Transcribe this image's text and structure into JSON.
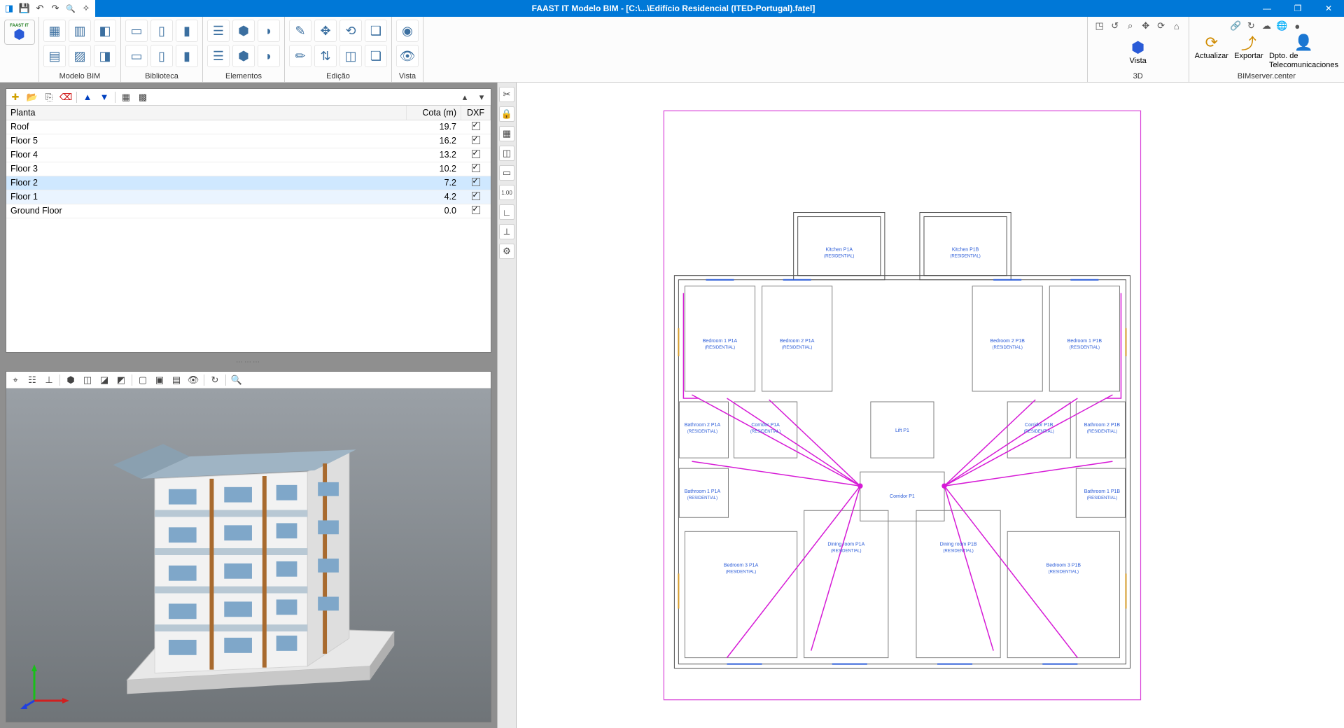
{
  "titlebar": {
    "title": "FAAST IT Modelo BIM - [C:\\...\\Edifício Residencial (ITED-Portugal).fatel]"
  },
  "ribbon": {
    "app_logo_top": "FAAST IT",
    "groups": {
      "modelo": "Modelo BIM",
      "biblioteca": "Biblioteca",
      "elementos": "Elementos",
      "edicao": "Edição",
      "vista": "Vista"
    },
    "right": {
      "vista": "Vista",
      "d3": "3D",
      "actualizar": "Actualizar",
      "exportar": "Exportar",
      "dpto": "Dpto. de\nTelecomunicaciones",
      "bimserver": "BIMserver.center"
    }
  },
  "floor_table": {
    "headers": {
      "planta": "Planta",
      "cota": "Cota (m)",
      "dxf": "DXF"
    },
    "rows": [
      {
        "name": "Roof",
        "cota": "19.7",
        "dxf": true,
        "selected": false
      },
      {
        "name": "Floor 5",
        "cota": "16.2",
        "dxf": true,
        "selected": false
      },
      {
        "name": "Floor 4",
        "cota": "13.2",
        "dxf": true,
        "selected": false
      },
      {
        "name": "Floor 3",
        "cota": "10.2",
        "dxf": true,
        "selected": false
      },
      {
        "name": "Floor 2",
        "cota": "7.2",
        "dxf": true,
        "selected": true
      },
      {
        "name": "Floor 1",
        "cota": "4.2",
        "dxf": true,
        "selected": "alt"
      },
      {
        "name": "Ground Floor",
        "cota": "0.0",
        "dxf": true,
        "selected": false
      }
    ]
  },
  "plan_rooms": {
    "kitchen_a": {
      "l1": "Kitchen P1A",
      "l2": "(RESIDENTIAL)"
    },
    "kitchen_b": {
      "l1": "Kitchen P1B",
      "l2": "(RESIDENTIAL)"
    },
    "bed1_a": {
      "l1": "Bedroom 1 P1A",
      "l2": "(RESIDENTIAL)"
    },
    "bed2_a": {
      "l1": "Bedroom 2 P1A",
      "l2": "(RESIDENTIAL)"
    },
    "bed2_b": {
      "l1": "Bedroom 2 P1B",
      "l2": "(RESIDENTIAL)"
    },
    "bed1_b": {
      "l1": "Bedroom 1 P1B",
      "l2": "(RESIDENTIAL)"
    },
    "bath2_a": {
      "l1": "Bathroom 2 P1A",
      "l2": "(RESIDENTIAL)"
    },
    "corr_a": {
      "l1": "Corridor P1A",
      "l2": "(RESIDENTIAL)"
    },
    "lift": {
      "l1": "Lift P1",
      "l2": ""
    },
    "corr_b": {
      "l1": "Corridor P1B",
      "l2": "(RESIDENTIAL)"
    },
    "bath2_b": {
      "l1": "Bathroom 2 P1B",
      "l2": "(RESIDENTIAL)"
    },
    "bath1_a": {
      "l1": "Bathroom 1 P1A",
      "l2": "(RESIDENTIAL)"
    },
    "corridor": {
      "l1": "Corridor P1",
      "l2": ""
    },
    "bath1_b": {
      "l1": "Bathroom 1 P1B",
      "l2": "(RESIDENTIAL)"
    },
    "dining_a": {
      "l1": "Dining room P1A",
      "l2": "(RESIDENTIAL)"
    },
    "dining_b": {
      "l1": "Dining room P1B",
      "l2": "(RESIDENTIAL)"
    },
    "bed3_a": {
      "l1": "Bedroom 3 P1A",
      "l2": "(RESIDENTIAL)"
    },
    "bed3_b": {
      "l1": "Bedroom 3 P1B",
      "l2": "(RESIDENTIAL)"
    }
  }
}
